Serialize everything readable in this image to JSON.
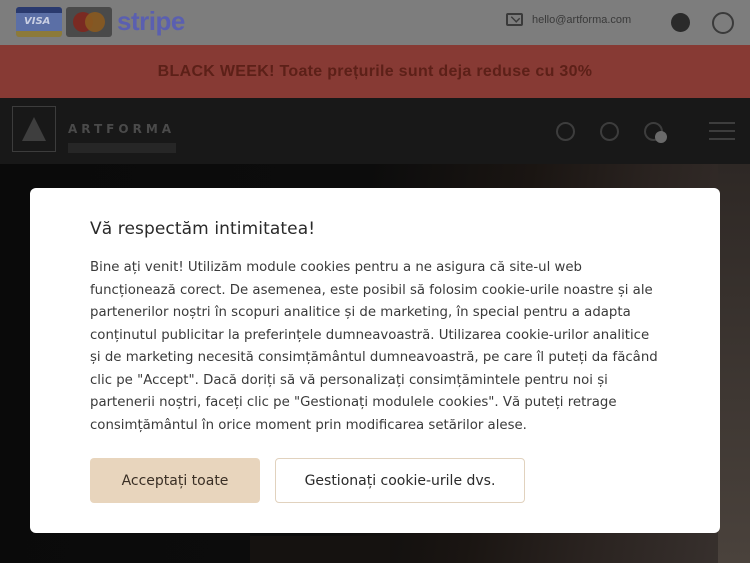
{
  "topbar": {
    "payment_visa": "VISA",
    "payment_stripe": "stripe",
    "email": "hello@artforma.com"
  },
  "promo": {
    "text": "BLACK WEEK! Toate prețurile sunt deja reduse cu 30%"
  },
  "nav": {
    "brand": "ARTFORMA"
  },
  "cookie_modal": {
    "title": "Vă respectăm intimitatea!",
    "body": "Bine ați venit! Utilizăm module cookies pentru a ne asigura că site-ul web funcționează corect. De asemenea, este posibil să folosim cookie-urile noastre și ale partenerilor noștri în scopuri analitice și de marketing, în special pentru a adapta conținutul publicitar la preferințele dumneavoastră. Utilizarea cookie-urilor analitice și de marketing necesită consimțământul dumneavoastră, pe care îl puteți da făcând clic pe \"Accept\". Dacă doriți să vă personalizați consimțămintele pentru noi și partenerii noștri, faceți clic pe \"Gestionați modulele cookies\". Vă puteți retrage consimțământul în orice moment prin modificarea setărilor alese.",
    "accept_label": "Acceptați toate",
    "manage_label": "Gestionați cookie-urile dvs."
  },
  "colors": {
    "promo_bg": "#873a34",
    "accept_bg": "#e8d5bd"
  },
  "icons": [
    "envelope-icon",
    "globe-icon",
    "whatsapp-icon",
    "search-icon",
    "user-icon",
    "cart-icon",
    "menu-icon"
  ]
}
